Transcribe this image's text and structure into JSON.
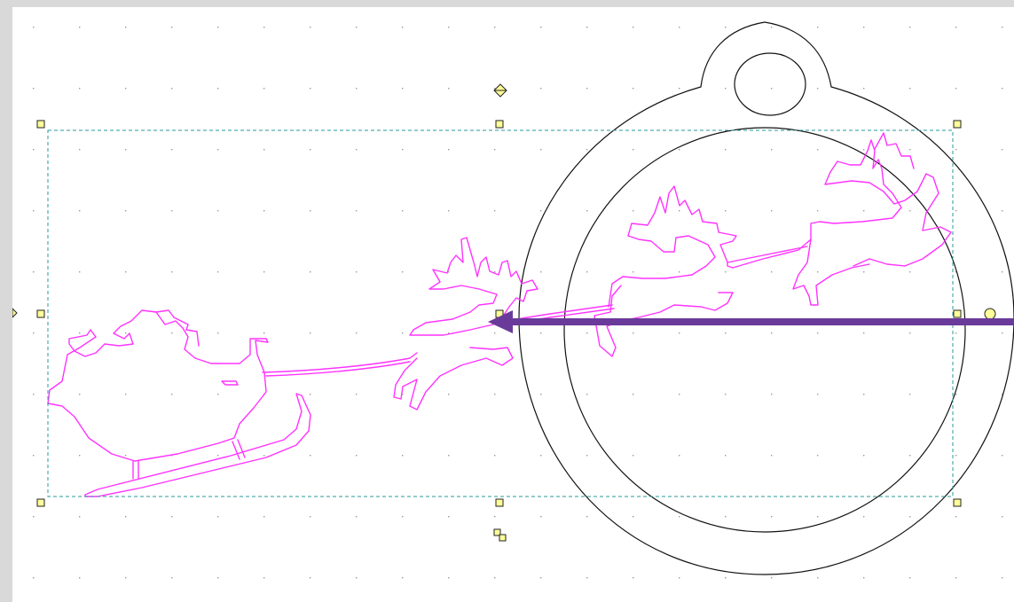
{
  "app": {
    "view": "vector-drawing-editor-canvas",
    "colors": {
      "workspace": "#d9d9d9",
      "canvas": "#ffffff",
      "grid_dot": "#9a9a9a",
      "selection_box": "#2a9a9a",
      "handle_fill": "#ffff99",
      "ornament_stroke": "#111111",
      "design_stroke": "#ff33ff",
      "annotation_arrow": "#6a3a9a"
    },
    "icons": {
      "rotation_handle": "diamond-rotate-icon",
      "duplicate_handle": "duplicate-squares-icon",
      "selection_handle": "square-handle-icon",
      "annotation": "arrow-left-icon"
    }
  }
}
